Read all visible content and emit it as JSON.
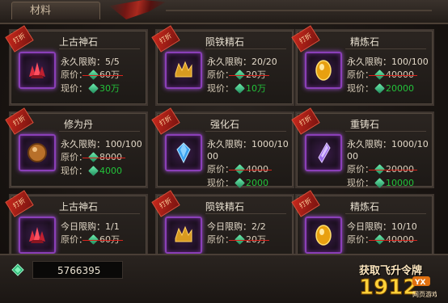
{
  "tab": {
    "label": "材料"
  },
  "cards": [
    {
      "tag": "打折",
      "name": "上古神石",
      "limit": "永久限购：5/5",
      "orig_label": "原价：",
      "orig": "60万",
      "now_label": "现价：",
      "now": "30万",
      "gem": "red-crystal"
    },
    {
      "tag": "打折",
      "name": "陨铁精石",
      "limit": "永久限购：20/20",
      "orig_label": "原价：",
      "orig": "20万",
      "now_label": "现价：",
      "now": "10万",
      "gem": "gold-ore"
    },
    {
      "tag": "打折",
      "name": "精炼石",
      "limit": "永久限购：100/100",
      "orig_label": "原价：",
      "orig": "40000",
      "now_label": "现价：",
      "now": "20000",
      "gem": "amber-stone"
    },
    {
      "tag": "打折",
      "name": "修为丹",
      "limit": "永久限购：100/100",
      "orig_label": "原价：",
      "orig": "8000",
      "now_label": "现价：",
      "now": "4000",
      "gem": "bronze-pill"
    },
    {
      "tag": "打折",
      "name": "强化石",
      "limit": "永久限购：1000/1000",
      "orig_label": "原价：",
      "orig": "4000",
      "now_label": "现价：",
      "now": "2000",
      "gem": "blue-crystal"
    },
    {
      "tag": "打折",
      "name": "重铸石",
      "limit": "永久限购：1000/1000",
      "orig_label": "原价：",
      "orig": "20000",
      "now_label": "现价：",
      "now": "10000",
      "gem": "purple-crystal"
    },
    {
      "tag": "打折",
      "name": "上古神石",
      "limit": "今日限购：1/1",
      "orig_label": "原价：",
      "orig": "60万",
      "now_label": "",
      "now": "",
      "gem": "red-crystal"
    },
    {
      "tag": "打折",
      "name": "陨铁精石",
      "limit": "今日限购：2/2",
      "orig_label": "原价：",
      "orig": "20万",
      "now_label": "",
      "now": "",
      "gem": "gold-ore"
    },
    {
      "tag": "打折",
      "name": "精炼石",
      "limit": "今日限购：10/10",
      "orig_label": "原价：",
      "orig": "40000",
      "now_label": "",
      "now": "",
      "gem": "amber-stone"
    }
  ],
  "footer": {
    "currency_icon": "jade-icon",
    "balance": "5766395",
    "promo_title": "获取飞升令牌",
    "promo_logo": "1912",
    "promo_badge": "YX",
    "promo_sub": "网页游戏"
  },
  "colors": {
    "accent": "#8a3fb8",
    "price_now": "#22c23a",
    "strike": "#d8231c",
    "tag": "#c8281c"
  }
}
